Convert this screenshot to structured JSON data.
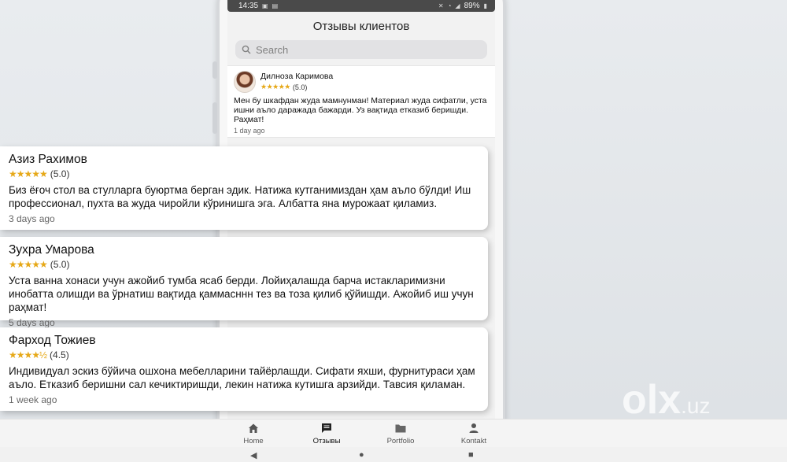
{
  "statusbar": {
    "time": "14:35",
    "battery": "89%"
  },
  "app": {
    "title": "Отзывы клиентов"
  },
  "search": {
    "placeholder": "Search"
  },
  "phone_review": {
    "name": "Дилноза Каримова",
    "stars": "★★★★★",
    "rating": "(5.0)",
    "text": "Мен бу шкафдан жуда мамнунман! Материал жуда сифатли, уста ишни аъло даражада бажарди. Уз вақтида етказиб беришди. Раҳмат!",
    "time": "1 day ago"
  },
  "reviews": [
    {
      "name": "Азиз Рахимов",
      "stars": "★★★★★",
      "rating": "(5.0)",
      "text": "Биз ёғоч стол ва стулларга буюртма берган эдик. Натижа кутганимиздан ҳам аъло бўлди! Иш профессионал, пухта ва жуда чиройли кўринишга эга. Албатта яна мурожаат қиламиз.",
      "time": "3 days ago"
    },
    {
      "name": "Зухра Умарова",
      "stars": "★★★★★",
      "rating": "(5.0)",
      "text": "Уста ванна хонаси учун ажойиб тумба ясаб берди. Лойиҳалашда барча истакларимизни инобатта олишди ва ўрнатиш вақтида қаммасннн тез ва тоза қилиб қўйишди. Ажойиб иш учун раҳмат!",
      "time": "5 days ago"
    },
    {
      "name": "Фарход Тожиев",
      "stars": "★★★★½",
      "rating": "(4.5)",
      "text": "Индивидуал эскиз бўйича ошхона мебелларини тайёрлашди. Сифати яхши, фурнитураси ҳам аъло. Етказиб беришни сал кечиктиришди, лекин натижа кутишга арзийди. Тавсия қиламан.",
      "time": "1 week ago"
    }
  ],
  "nav": {
    "home": "Home",
    "reviews": "Отзывы",
    "portfolio": "Portfolio",
    "contact": "Kontakt"
  },
  "watermark": {
    "brand": "olx",
    "domain": ".uz"
  },
  "colors": {
    "star": "#e6a817",
    "background": "#e4e7ea",
    "statusbar": "#4a4a4a"
  }
}
